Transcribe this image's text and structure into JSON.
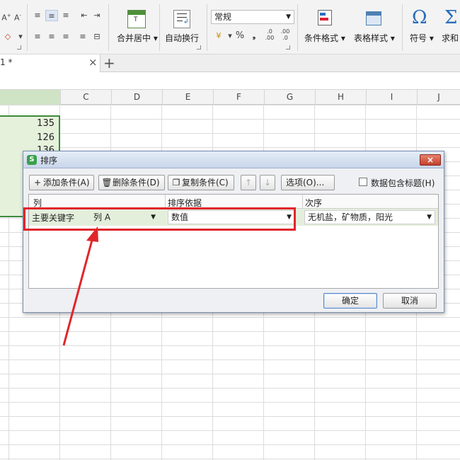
{
  "ribbon": {
    "merge_center_label": "合并居中",
    "wrap_text_label": "自动换行",
    "number_format_value": "常规",
    "percent_label": "%",
    "thousands_label": "❟",
    "dec_inc_label": ".00\n+.0",
    "conditional_format_label": "条件格式",
    "table_style_label": "表格样式",
    "symbol_label": "符号",
    "sum_label": "求和",
    "omega_glyph": "Ω",
    "sigma_glyph": "Σ"
  },
  "tabbar": {
    "sheet_tab_label": "1 *",
    "close_glyph": "×",
    "add_glyph": "+"
  },
  "columns": [
    "C",
    "D",
    "E",
    "F",
    "G",
    "H",
    "I",
    "J"
  ],
  "cells": [
    "135",
    "126",
    "136"
  ],
  "dialog": {
    "title": "排序",
    "add_condition": "添加条件(A)",
    "delete_condition": "删除条件(D)",
    "copy_condition": "复制条件(C)",
    "options": "选项(O)...",
    "header_checkbox_label": "数据包含标题(H)",
    "col_header_column": "列",
    "col_header_basis": "排序依据",
    "col_header_order": "次序",
    "primary_key_label": "主要关键字",
    "column_value": "列 A",
    "basis_value": "数值",
    "order_value": "无机盐，矿物质，阳光",
    "ok": "确定",
    "cancel": "取消"
  },
  "colors": {
    "accent_green": "#3c8a3c",
    "annotation_red": "#e0262a"
  },
  "icons": {
    "up": "↑",
    "down": "↓",
    "dropdown": "▼",
    "close": "×"
  }
}
